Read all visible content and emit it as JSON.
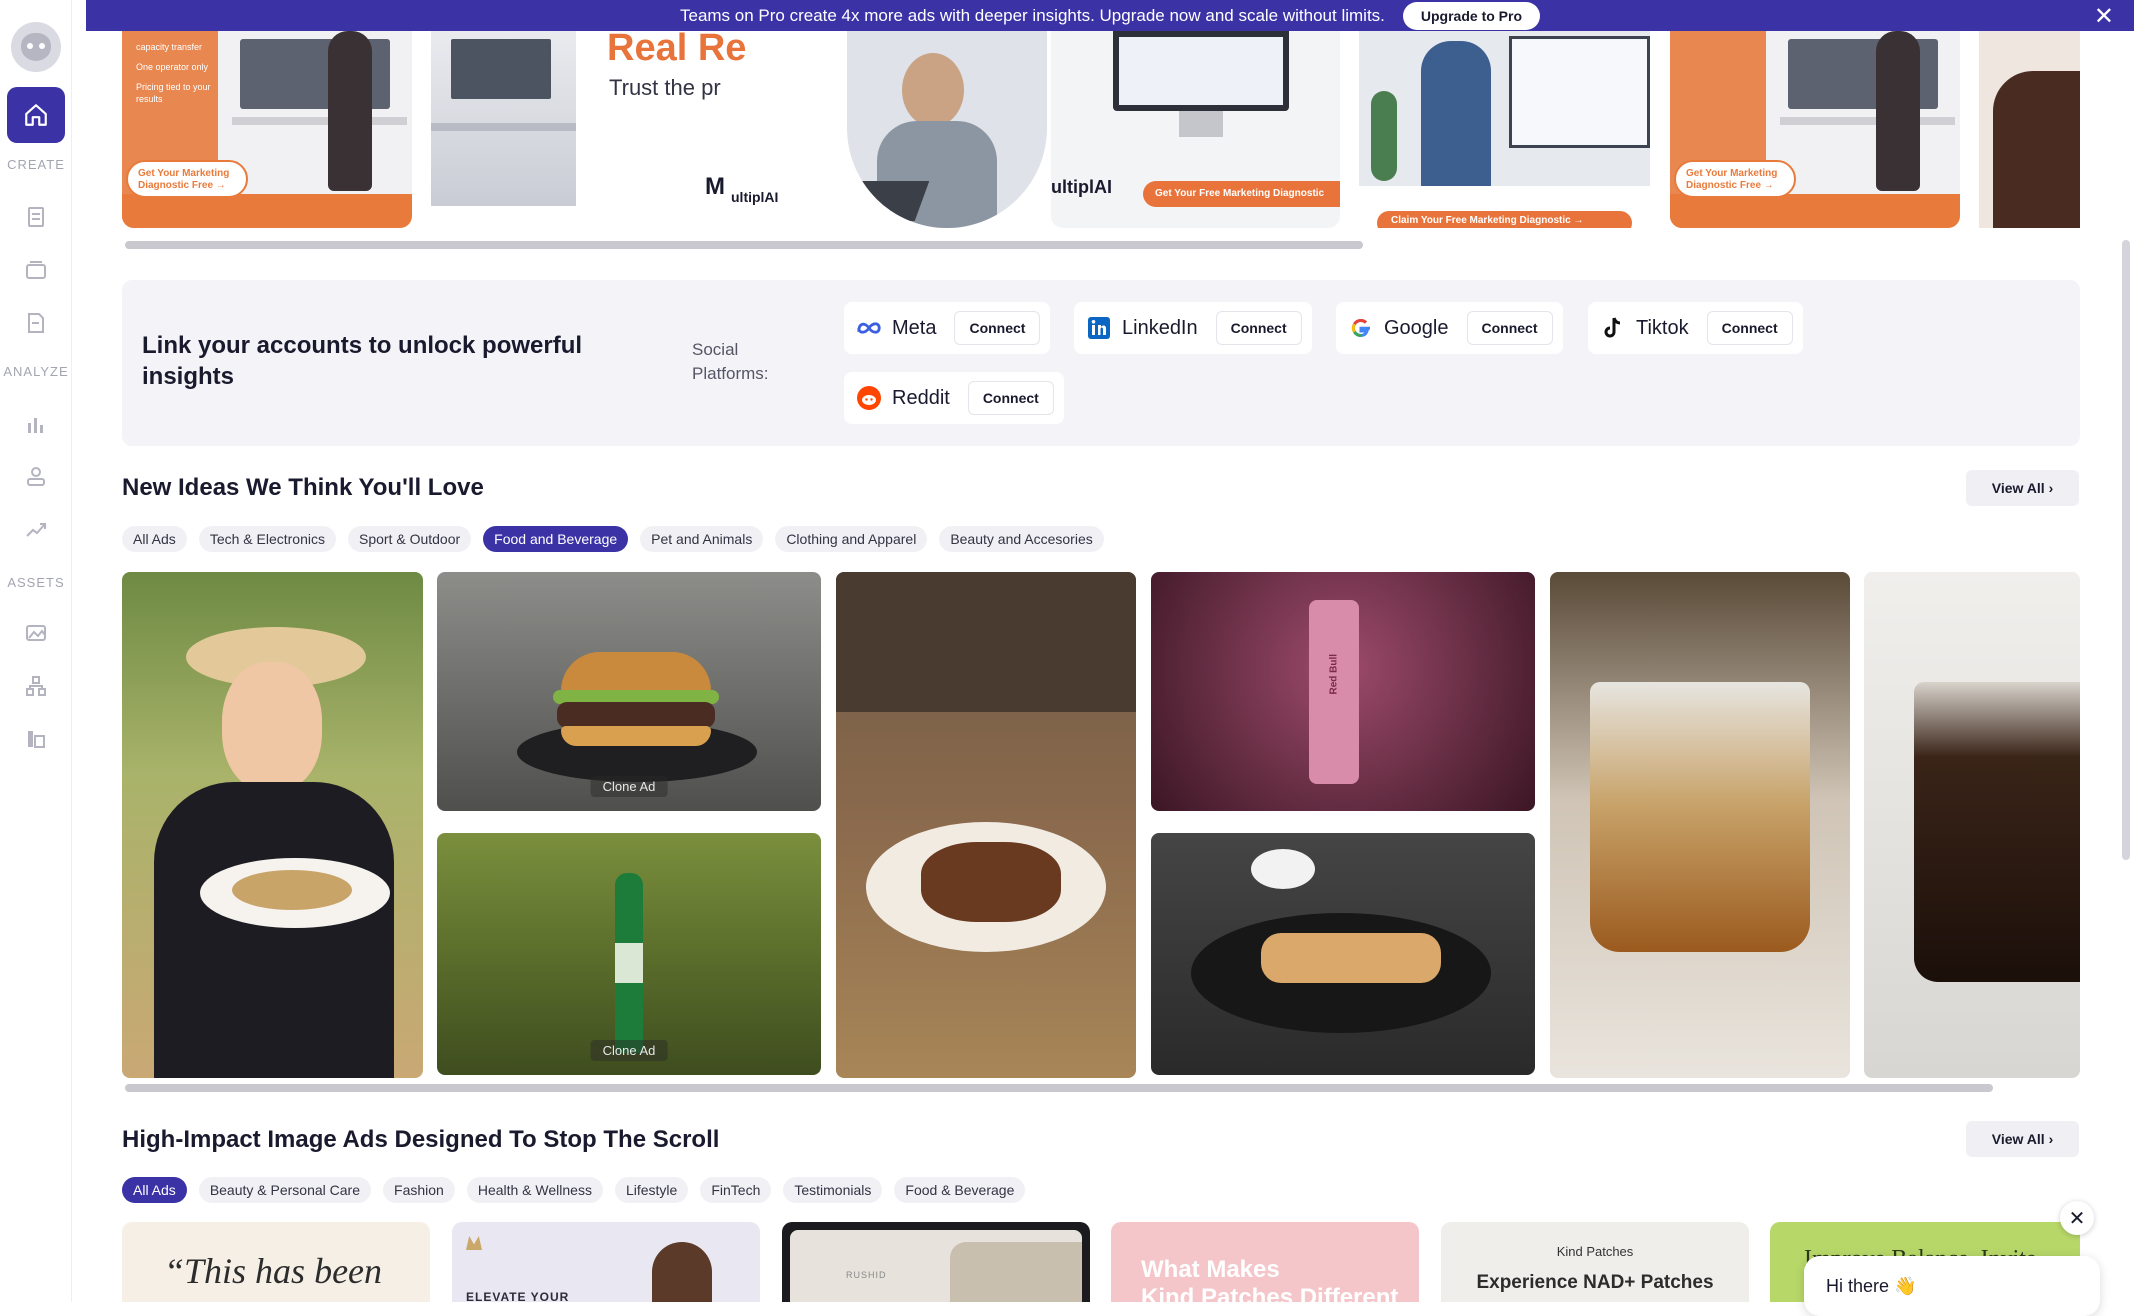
{
  "banner": {
    "text": "Teams on Pro create 4x more ads with deeper insights. Upgrade now and scale without limits.",
    "button": "Upgrade to Pro",
    "close": "✕"
  },
  "sidebar": {
    "sections": [
      "CREATE",
      "ANALYZE",
      "ASSETS"
    ],
    "icons": [
      "logo-icon",
      "home-icon",
      "document-icon",
      "layers-icon",
      "edit-doc-icon",
      "bar-chart-icon",
      "network-icon",
      "trend-icon",
      "gallery-icon",
      "hierarchy-icon",
      "library-icon"
    ]
  },
  "top_ads": {
    "ad1_pill": "Get Your Marketing Diagnostic Free →",
    "ad1_bullets": [
      "capacity transfer",
      "One operator only",
      "Pricing tied to your results"
    ],
    "ad2_headline": "Real Re",
    "ad2_sub": "Trust the pr",
    "ad2_logo_m": "M",
    "ad2_logo_tail": "ultiplAI",
    "ad3_brand": "ultiplAI",
    "ad3_cta": "Get Your Free Marketing Diagnostic",
    "ad4_cta": "Claim Your Free Marketing Diagnostic →",
    "ad5_pill": "Get Your Marketing Diagnostic Free →"
  },
  "link_accounts": {
    "title": "Link your accounts to unlock powerful insights",
    "social_label": "Social Platforms:",
    "platforms": [
      {
        "name": "Meta",
        "button": "Connect"
      },
      {
        "name": "LinkedIn",
        "button": "Connect"
      },
      {
        "name": "Google",
        "button": "Connect"
      },
      {
        "name": "Tiktok",
        "button": "Connect"
      },
      {
        "name": "Reddit",
        "button": "Connect"
      }
    ]
  },
  "ideas": {
    "title": "New Ideas We Think You'll Love",
    "view_all": "View All ›",
    "chips": [
      "All Ads",
      "Tech & Electronics",
      "Sport & Outdoor",
      "Food and Beverage",
      "Pet and Animals",
      "Clothing and Apparel",
      "Beauty and Accesories"
    ],
    "active_chip": "Food and Beverage",
    "clone_label": "Clone Ad",
    "can_text": "Red Bull"
  },
  "image_ads": {
    "title": "High-Impact Image Ads Designed To Stop The Scroll",
    "view_all": "View All ›",
    "chips": [
      "All Ads",
      "Beauty & Personal Care",
      "Fashion",
      "Health & Wellness",
      "Lifestyle",
      "FinTech",
      "Testimonials",
      "Food & Beverage"
    ],
    "active_chip": "All Ads",
    "cards": {
      "quote": "“This has been",
      "elevate": "ELEVATE YOUR",
      "tablet_brand": "RUSHID",
      "pink_headline": "What Makes",
      "pink_sub": "Kind Patches Different",
      "kind_brand": "Kind Patches",
      "kind_headline": "Experience NAD+ Patches",
      "green_headline": "Improve Balance, Invite"
    }
  },
  "chat": {
    "greeting": "Hi there 👋",
    "close": "✕"
  }
}
